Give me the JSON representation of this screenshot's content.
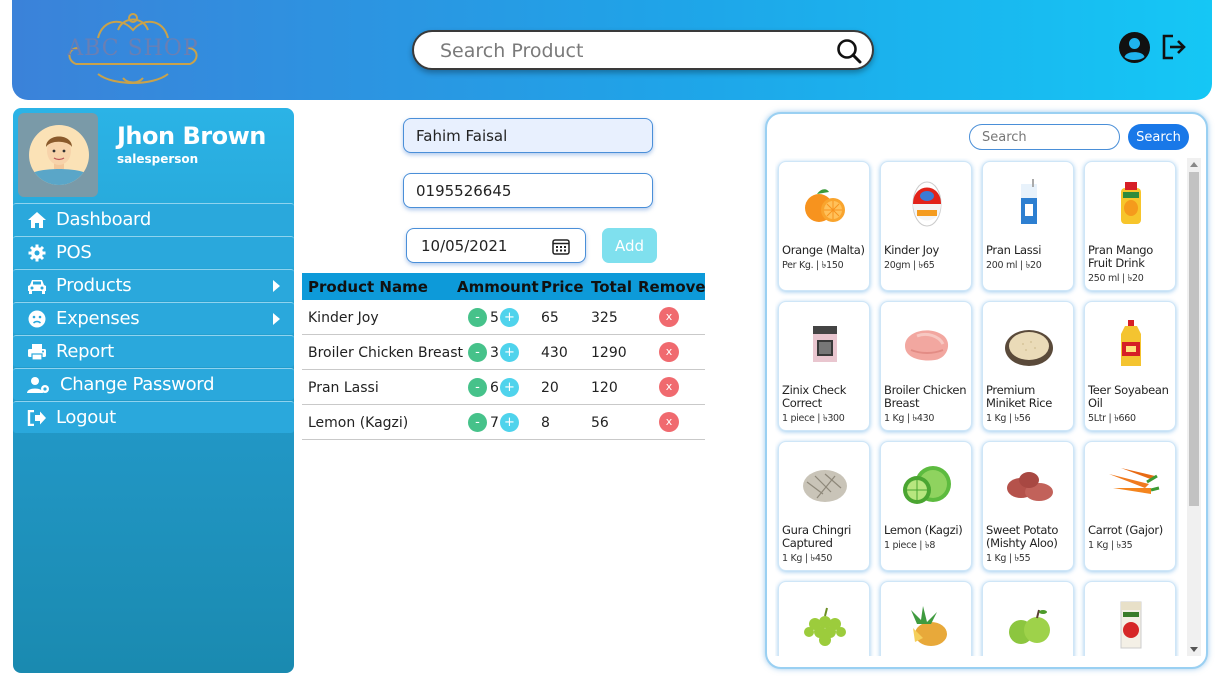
{
  "header": {
    "logo_text": "ABC SHOP",
    "search_placeholder": "Search Product"
  },
  "profile": {
    "name": "Jhon Brown",
    "role": "salesperson"
  },
  "menu": [
    {
      "label": "Dashboard",
      "icon": "home-icon",
      "has_submenu": false
    },
    {
      "label": "POS",
      "icon": "gear-icon",
      "has_submenu": false
    },
    {
      "label": "Products",
      "icon": "car-icon",
      "has_submenu": true
    },
    {
      "label": "Expenses",
      "icon": "frown-icon",
      "has_submenu": true
    },
    {
      "label": "Report",
      "icon": "printer-icon",
      "has_submenu": false
    },
    {
      "label": "Change Password",
      "icon": "user-gear-icon",
      "has_submenu": false
    },
    {
      "label": "Logout",
      "icon": "sign-out-icon",
      "has_submenu": false
    }
  ],
  "form": {
    "customer_name": "Fahim Faisal",
    "phone": "0195526645",
    "date": "10/05/2021",
    "add_label": "Add"
  },
  "cart": {
    "headers": [
      "Product Name",
      "Ammount",
      "Price",
      "Total",
      "Remove"
    ],
    "rows": [
      {
        "name": "Kinder Joy",
        "qty": "5",
        "price": "65",
        "total": "325"
      },
      {
        "name": "Broiler Chicken Breast",
        "qty": "3",
        "price": "430",
        "total": "1290"
      },
      {
        "name": "Pran Lassi",
        "qty": "6",
        "price": "20",
        "total": "120"
      },
      {
        "name": "Lemon (Kagzi)",
        "qty": "7",
        "price": "8",
        "total": "56"
      }
    ],
    "minus_label": "-",
    "plus_label": "+",
    "remove_label": "x"
  },
  "panel": {
    "search_placeholder": "Search",
    "search_button": "Search",
    "products": [
      {
        "name": "Orange (Malta)",
        "meta": "Per Kg. | ৳150",
        "icon": "orange-icon"
      },
      {
        "name": "Kinder Joy",
        "meta": "20gm | ৳65",
        "icon": "kinder-joy-icon"
      },
      {
        "name": "Pran Lassi",
        "meta": "200 ml | ৳20",
        "icon": "lassi-pack-icon"
      },
      {
        "name": "Pran Mango Fruit Drink",
        "meta": "250 ml | ৳20",
        "icon": "mango-drink-icon"
      },
      {
        "name": "Zinix Check Correct",
        "meta": "1 piece | ৳300",
        "icon": "zinix-pack-icon"
      },
      {
        "name": "Broiler Chicken Breast",
        "meta": "1 Kg | ৳430",
        "icon": "chicken-breast-icon"
      },
      {
        "name": "Premium Miniket Rice",
        "meta": "1 Kg | ৳56",
        "icon": "rice-bowl-icon"
      },
      {
        "name": "Teer Soyabean Oil",
        "meta": "5Ltr | ৳660",
        "icon": "oil-bottle-icon"
      },
      {
        "name": "Gura Chingri Captured",
        "meta": "1 Kg | ৳450",
        "icon": "shrimp-icon"
      },
      {
        "name": "Lemon (Kagzi)",
        "meta": "1 piece | ৳8",
        "icon": "lemon-icon"
      },
      {
        "name": "Sweet Potato (Mishty Aloo)",
        "meta": "1 Kg | ৳55",
        "icon": "sweet-potato-icon"
      },
      {
        "name": "Carrot (Gajor)",
        "meta": "1 Kg | ৳35",
        "icon": "carrot-icon"
      },
      {
        "name": "",
        "meta": "",
        "icon": "grapes-icon"
      },
      {
        "name": "",
        "meta": "",
        "icon": "pineapple-icon"
      },
      {
        "name": "",
        "meta": "",
        "icon": "green-apple-icon"
      },
      {
        "name": "",
        "meta": "",
        "icon": "juice-carton-icon"
      }
    ]
  },
  "colors": {
    "header_start": "#3b82d9",
    "header_end": "#15c7f5",
    "sidebar": "#2aa8dc",
    "table_header": "#0d9ad9",
    "search_button": "#1978e8",
    "remove": "#f06a6f",
    "minus": "#46c28a",
    "plus": "#4fd3ec"
  }
}
